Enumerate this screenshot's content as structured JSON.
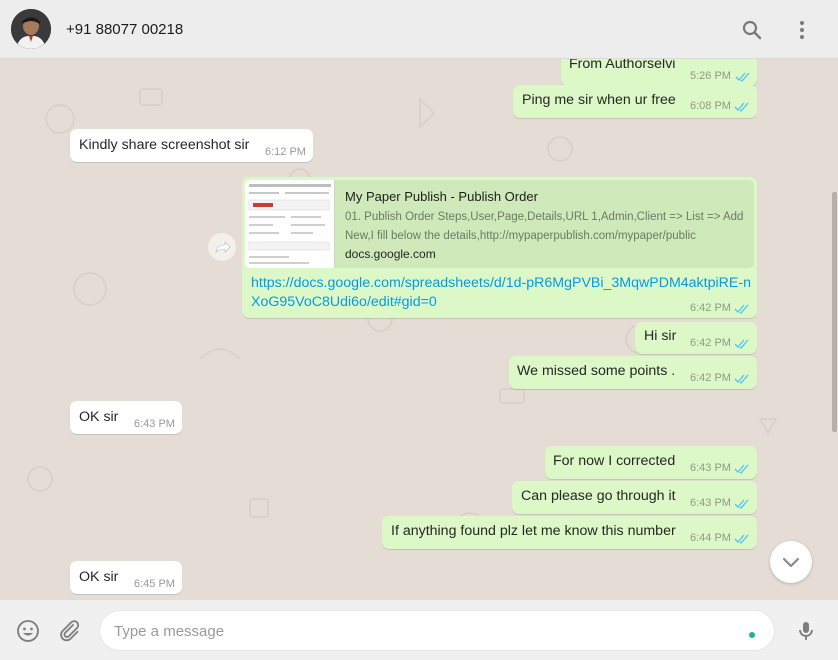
{
  "header": {
    "contact_name": "+91 88077 00218",
    "search_icon": "search-icon",
    "menu_icon": "more-vertical-icon"
  },
  "messages": [
    {
      "dir": "out",
      "text": "From Authorselvi",
      "time": "5:26 PM"
    },
    {
      "dir": "out",
      "text": "Ping me sir when ur free",
      "time": "6:08 PM"
    },
    {
      "dir": "in",
      "text": "Kindly share screenshot sir",
      "time": "6:12 PM"
    },
    {
      "dir": "out",
      "type": "link",
      "preview_title": "My Paper Publish - Publish Order",
      "preview_desc": "01. Publish Order Steps,User,Page,Details,URL 1,Admin,Client => List => Add New,I fill below the details,http://mypaperpublish.com/mypaper/public",
      "preview_domain": "docs.google.com",
      "text": "https://docs.google.com/spreadsheets/d/1d-pR6MgPVBi_3MqwPDM4aktpiRE-nXoG95VoC8Udi6o/edit#gid=0",
      "time": "6:42 PM"
    },
    {
      "dir": "out",
      "text": "Hi sir",
      "time": "6:42 PM"
    },
    {
      "dir": "out",
      "text": "We missed some points .",
      "time": "6:42 PM"
    },
    {
      "dir": "in",
      "text": "OK sir",
      "time": "6:43 PM"
    },
    {
      "dir": "out",
      "text": "For now I corrected",
      "time": "6:43 PM"
    },
    {
      "dir": "out",
      "text": "Can please go through it",
      "time": "6:43 PM"
    },
    {
      "dir": "out",
      "text": "If anything found plz let me know this number",
      "time": "6:44 PM"
    },
    {
      "dir": "in",
      "text": "OK sir",
      "time": "6:45 PM"
    }
  ],
  "composer": {
    "placeholder": "Type a message",
    "value": ""
  },
  "colors": {
    "outgoing_bubble": "#dcf8c6",
    "incoming_bubble": "#ffffff",
    "read_tick": "#4fc3f7",
    "link": "#039be5",
    "chat_background": "#e5ddd5"
  }
}
